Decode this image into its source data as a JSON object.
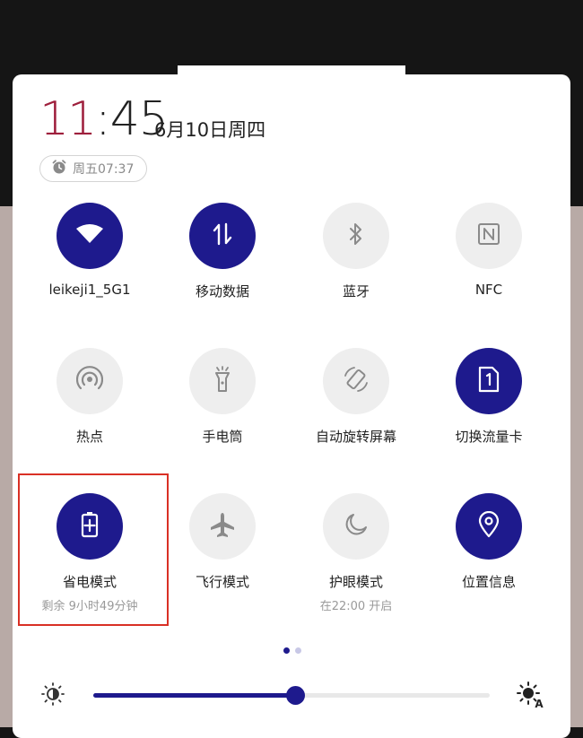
{
  "clock": {
    "hour": "11",
    "separator": ":",
    "minute": "45"
  },
  "date": "6月10日周四",
  "alarm": {
    "icon": "alarm-clock-icon",
    "text": "周五07:37"
  },
  "tiles": [
    {
      "id": "wifi",
      "label": "leikeji1_5G1",
      "icon": "wifi-icon",
      "active": true
    },
    {
      "id": "mobile-data",
      "label": "移动数据",
      "icon": "mobile-data-icon",
      "active": true
    },
    {
      "id": "bluetooth",
      "label": "蓝牙",
      "icon": "bluetooth-icon",
      "active": false
    },
    {
      "id": "nfc",
      "label": "NFC",
      "icon": "nfc-icon",
      "active": false
    },
    {
      "id": "hotspot",
      "label": "热点",
      "icon": "hotspot-icon",
      "active": false
    },
    {
      "id": "flashlight",
      "label": "手电筒",
      "icon": "flashlight-icon",
      "active": false
    },
    {
      "id": "auto-rotate",
      "label": "自动旋转屏幕",
      "icon": "auto-rotate-icon",
      "active": false
    },
    {
      "id": "switch-sim",
      "label": "切换流量卡",
      "icon": "sim-card-icon",
      "active": true
    },
    {
      "id": "power-saving",
      "label": "省电模式",
      "sub": "剩余 9小时49分钟",
      "icon": "battery-saver-icon",
      "active": true
    },
    {
      "id": "airplane",
      "label": "飞行模式",
      "icon": "airplane-icon",
      "active": false
    },
    {
      "id": "eye-comfort",
      "label": "护眼模式",
      "sub": "在22:00 开启",
      "icon": "moon-icon",
      "active": false
    },
    {
      "id": "location",
      "label": "位置信息",
      "icon": "location-pin-icon",
      "active": true
    }
  ],
  "page_indicator": {
    "current": 1,
    "total": 2
  },
  "brightness": {
    "level_percent": 51,
    "left_icon": "brightness-low-icon",
    "right_icon": "auto-brightness-icon",
    "right_icon_letter": "A"
  },
  "colors": {
    "accent": "#1e1a8d",
    "clock_red": "#9e1f3c",
    "inactive": "#eeeeee",
    "highlight_box": "#d93025"
  }
}
